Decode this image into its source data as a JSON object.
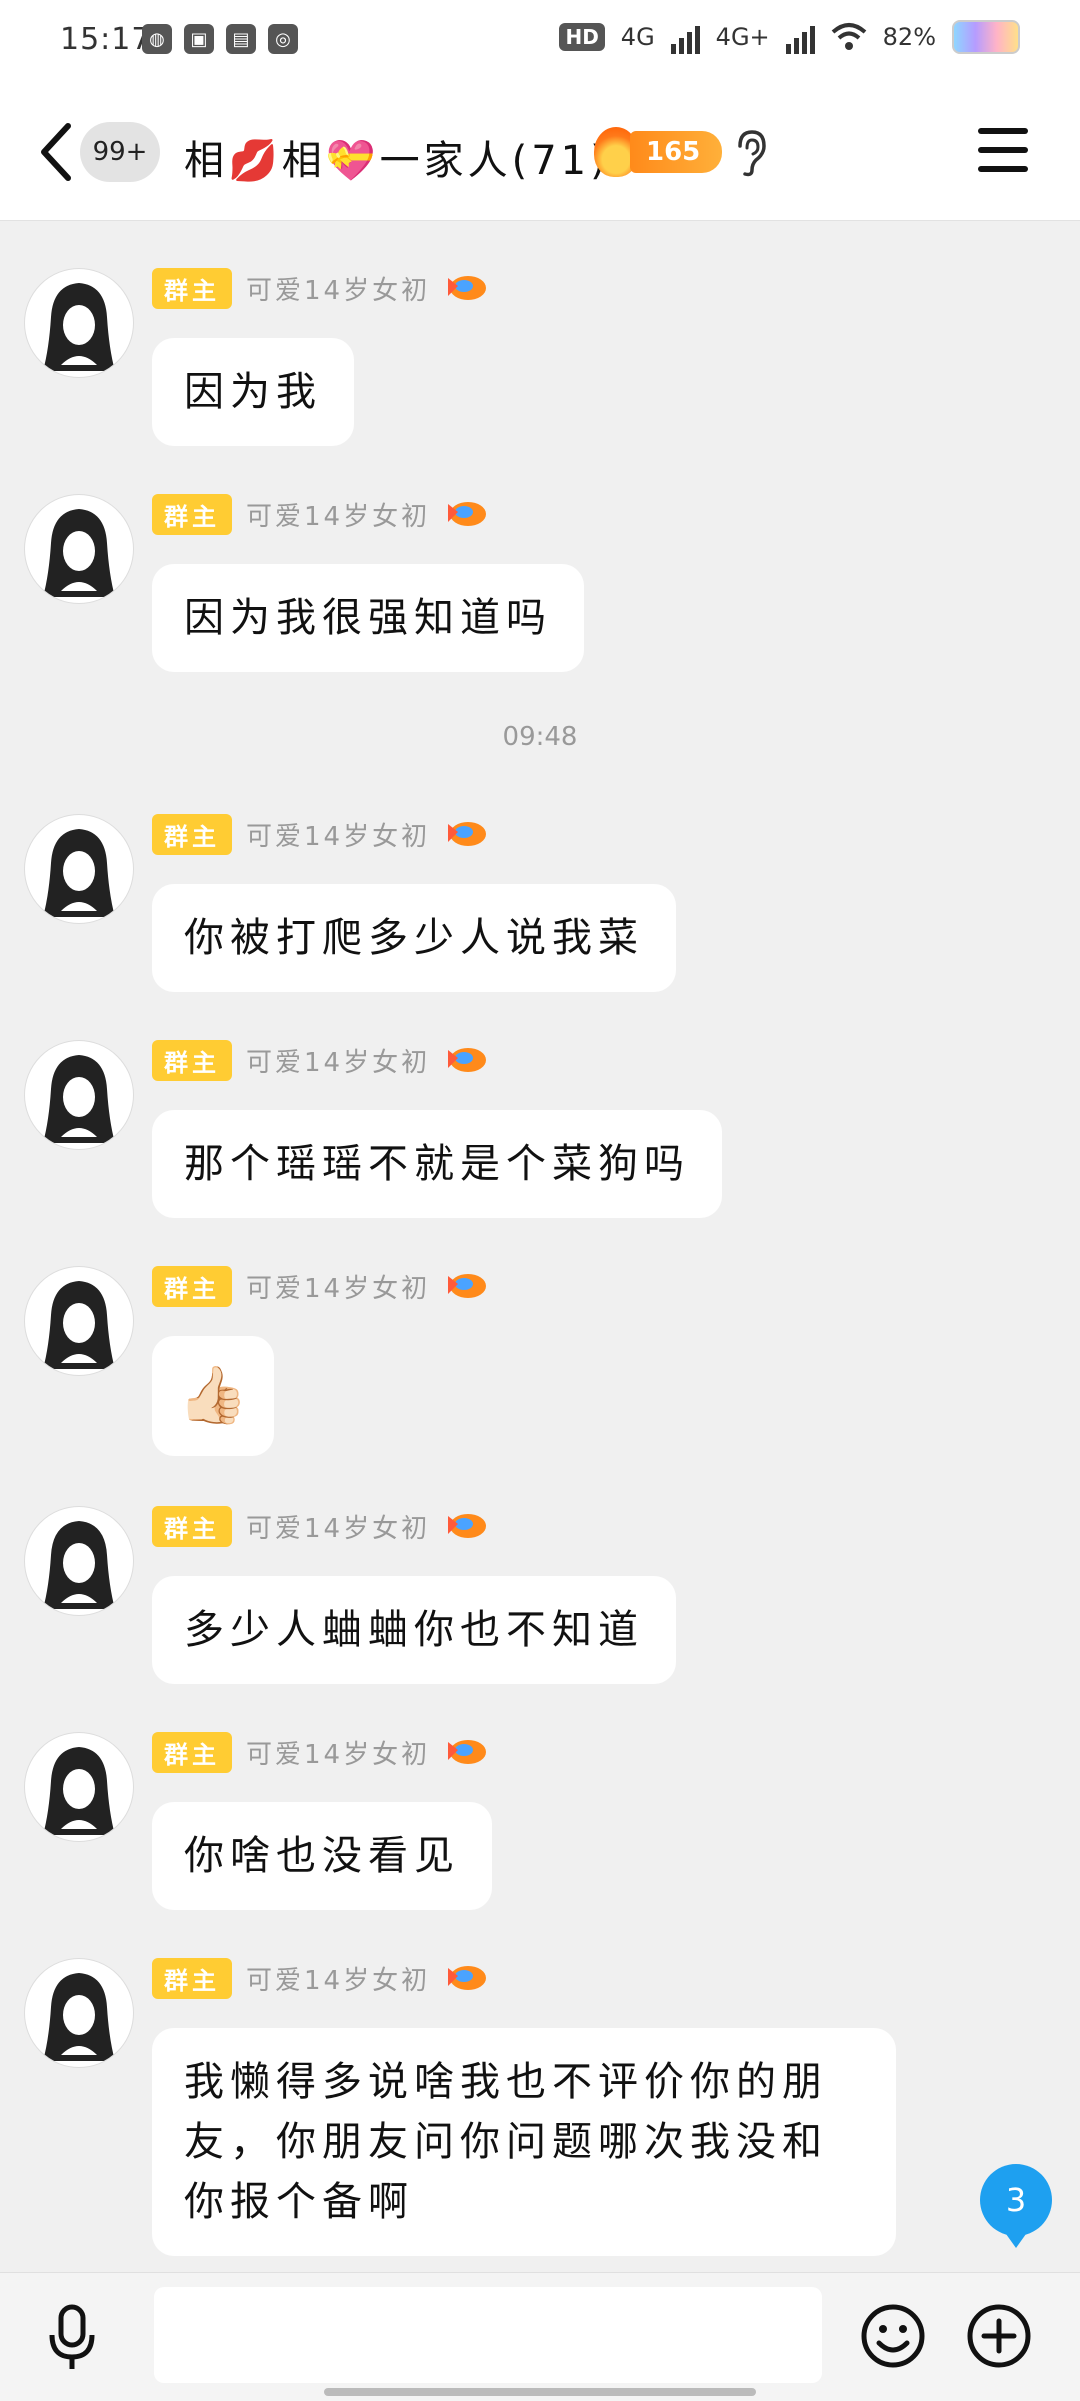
{
  "status": {
    "time": "15:17",
    "signal_a": "4G",
    "signal_b": "4G+",
    "battery": "82%"
  },
  "header": {
    "unread": "99+",
    "title": "相💋相💝一家人(71)",
    "fire_count": "165"
  },
  "messages": [
    {
      "role": "群主",
      "nick": "可爱14岁女初",
      "text": "因为我"
    },
    {
      "role": "群主",
      "nick": "可爱14岁女初",
      "text": "因为我很强知道吗"
    },
    {
      "role": "群主",
      "nick": "可爱14岁女初",
      "text": "你被打爬多少人说我菜"
    },
    {
      "role": "群主",
      "nick": "可爱14岁女初",
      "text": "那个瑶瑶不就是个菜狗吗"
    },
    {
      "role": "群主",
      "nick": "可爱14岁女初",
      "text": "👍🏻"
    },
    {
      "role": "群主",
      "nick": "可爱14岁女初",
      "text": "多少人蛐蛐你也不知道"
    },
    {
      "role": "群主",
      "nick": "可爱14岁女初",
      "text": "你啥也没看见"
    },
    {
      "role": "群主",
      "nick": "可爱14岁女初",
      "text": "我懒得多说啥我也不评价你的朋友，你朋友问你问题哪次我没和你报个备啊"
    }
  ],
  "timestamp": "09:48",
  "floating_badge": "3",
  "colors": {
    "role_badge": "#ffcc33",
    "fire_badge": "#ff8a1a",
    "float_badge": "#1ea0f0",
    "background": "#f0f0f0"
  },
  "icons": [
    "back-arrow-icon",
    "ear-icon",
    "menu-icon",
    "mic-icon",
    "emoji-icon",
    "plus-icon",
    "medal-icon"
  ]
}
